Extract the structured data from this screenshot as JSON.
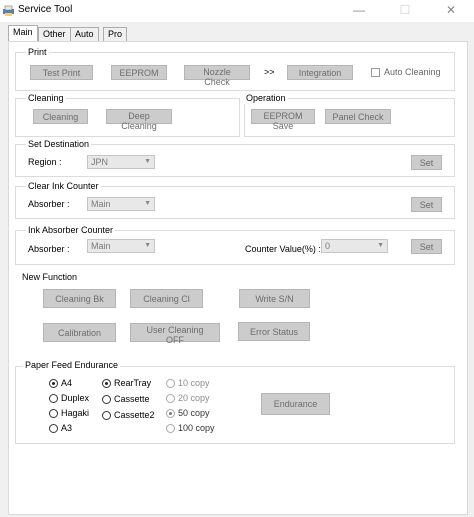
{
  "window": {
    "title": "Service Tool",
    "minimize": "—",
    "maximize": "☐",
    "close": "✕"
  },
  "tabs": [
    "Main",
    "Other",
    "Auto",
    "Pro"
  ],
  "print": {
    "title": "Print",
    "test_print": "Test Print",
    "eeprom": "EEPROM",
    "nozzle_check": "Nozzle Check",
    "arrow": ">>",
    "integration": "Integration",
    "auto_cleaning": "Auto Cleaning"
  },
  "cleaning": {
    "title": "Cleaning",
    "cleaning": "Cleaning",
    "deep_cleaning": "Deep Cleaning"
  },
  "operation": {
    "title": "Operation",
    "eeprom_save": "EEPROM Save",
    "panel_check": "Panel Check"
  },
  "set_destination": {
    "title": "Set Destination",
    "label": "Region :",
    "value": "JPN",
    "set": "Set"
  },
  "clear_ink_counter": {
    "title": "Clear Ink Counter",
    "label": "Absorber :",
    "value": "Main",
    "set": "Set"
  },
  "ink_absorber_counter": {
    "title": "Ink Absorber Counter",
    "label": "Absorber :",
    "value": "Main",
    "counter_label": "Counter Value(%) :",
    "counter_value": "0",
    "set": "Set"
  },
  "new_function": {
    "title": "New Function",
    "cleaning_bk": "Cleaning Bk",
    "cleaning_cl": "Cleaning Cl",
    "write_sn": "Write S/N",
    "calibration": "Calibration",
    "user_cleaning_off": "User Cleaning OFF",
    "error_status": "Error Status"
  },
  "paper_feed": {
    "title": "Paper Feed Endurance",
    "sizes": [
      "A4",
      "Duplex",
      "Hagaki",
      "A3"
    ],
    "sources": [
      "RearTray",
      "Cassette",
      "Cassette2"
    ],
    "copies": [
      "10 copy",
      "20 copy",
      "50 copy",
      "100 copy"
    ],
    "endurance": "Endurance"
  }
}
